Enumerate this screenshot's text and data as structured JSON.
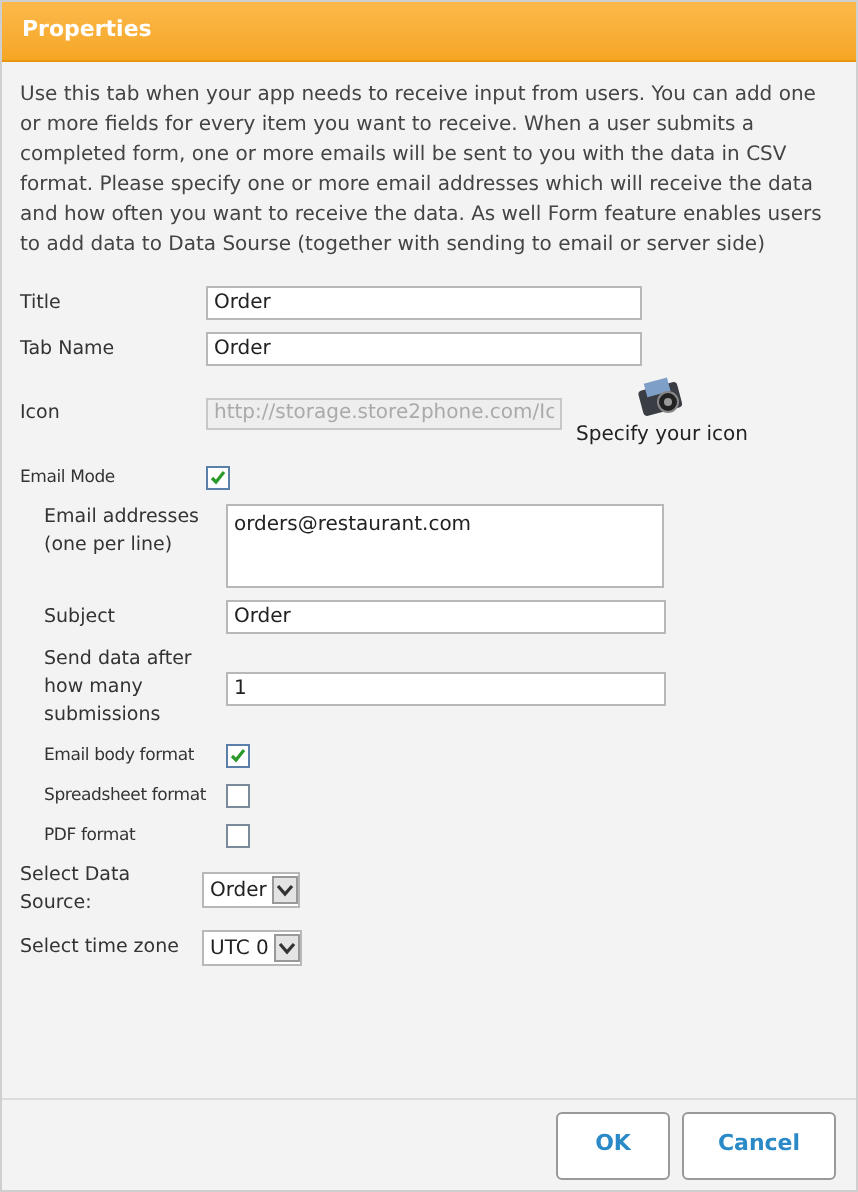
{
  "window": {
    "title": "Properties"
  },
  "description": "Use this tab when your app needs to receive input from users. You can add one or more fields for every item you want to receive. When a user submits a completed form, one or more emails will be sent to you with the data in CSV format. Please specify one or more email addresses which will receive the data and how often you want to receive the data. As well Form feature enables users to add data to Data Sourse (together with sending to email or server side)",
  "fields": [
    {
      "kind": "text",
      "label": "Title",
      "value": "Order"
    },
    {
      "kind": "text",
      "label": "Tab Name",
      "value": "Order"
    },
    {
      "kind": "icon",
      "label": "Icon",
      "value": "http://storage.store2phone.com/Ic",
      "disabled": true,
      "link": "Specify your icon"
    },
    {
      "kind": "checkbox",
      "label": "Email Mode",
      "checked": true,
      "children": [
        {
          "kind": "textarea",
          "label": "Email addresses (one per line)",
          "value": "orders@restaurant.com"
        },
        {
          "kind": "text",
          "label": "Subject",
          "value": "Order"
        },
        {
          "kind": "text",
          "label": "Send data after how many submissions",
          "value": "1"
        },
        {
          "kind": "checkbox",
          "label": "Email body format",
          "checked": true
        },
        {
          "kind": "checkbox",
          "label": "Spreadsheet format",
          "checked": false
        },
        {
          "kind": "checkbox",
          "label": "PDF format",
          "checked": false
        }
      ]
    },
    {
      "kind": "select",
      "label": "Select Data Source:",
      "value": "Order"
    },
    {
      "kind": "select",
      "label": "Select time zone",
      "value": "UTC 0"
    }
  ],
  "buttons": [
    "OK",
    "Cancel"
  ]
}
